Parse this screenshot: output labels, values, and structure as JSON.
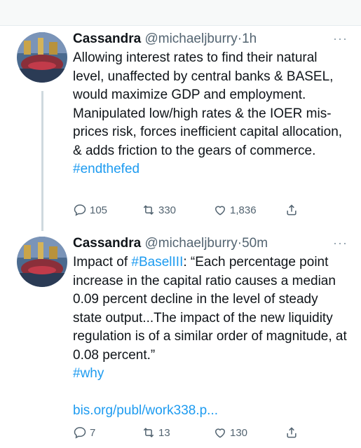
{
  "tweets": [
    {
      "author_name": "Cassandra",
      "handle": "@michaeljburry",
      "separator": "·",
      "time": "1h",
      "more_label": "···",
      "text": "Allowing interest rates to find their natural level, unaffected by central banks & BASEL, would maximize GDP and employment. Manipulated low/high rates & the IOER mis-prices risk, forces inefficient capital allocation, & adds friction to the gears of commerce.",
      "hashtag": "#endthefed",
      "replies": "105",
      "retweets": "330",
      "likes": "1,836"
    },
    {
      "author_name": "Cassandra",
      "handle": "@michaeljburry",
      "separator": "·",
      "time": "50m",
      "more_label": "···",
      "text_prefix": "Impact of ",
      "text_hashtag": "#BaselIII",
      "text_rest": ": “Each percentage point increase in the capital ratio causes a median 0.09 percent decline in the level of steady state output...The impact of the new liquidity regulation is of a similar order of magnitude, at 0.08 percent.”",
      "hashtag": "#why",
      "link": "bis.org/publ/work338.p...",
      "replies": "7",
      "retweets": "13",
      "likes": "130"
    }
  ],
  "icons": {
    "reply": "reply-icon",
    "retweet": "retweet-icon",
    "like": "heart-icon",
    "share": "share-icon"
  },
  "colors": {
    "link": "#1d9bf0",
    "secondary_text": "#536471",
    "thread_line": "#cfd9de"
  }
}
